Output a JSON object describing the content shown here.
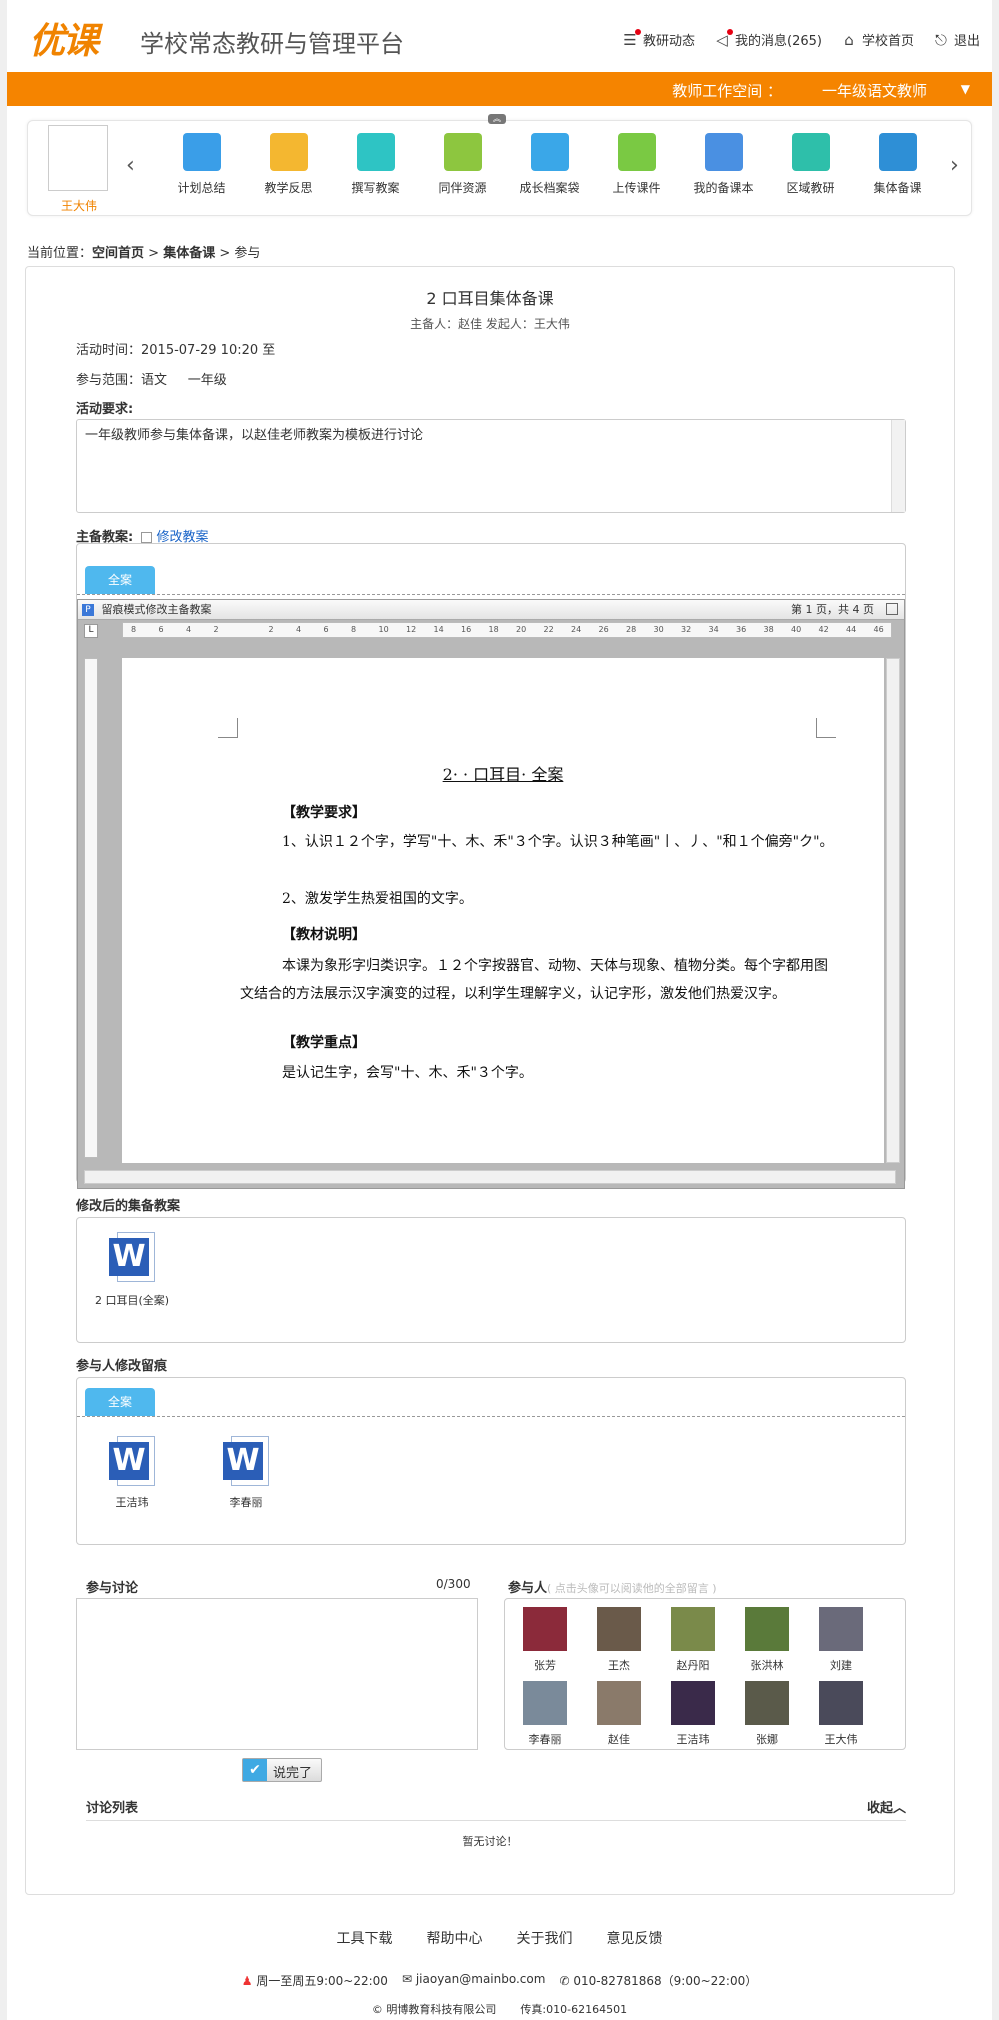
{
  "header": {
    "logo": "优课",
    "platform": "学校常态教研与管理平台",
    "nav": [
      {
        "label": "教研动态",
        "icon": "list-icon"
      },
      {
        "label": "我的消息(265)",
        "icon": "speaker-icon"
      },
      {
        "label": "学校首页",
        "icon": "school-icon"
      },
      {
        "label": "退出",
        "icon": "logout-icon"
      }
    ]
  },
  "workspace": {
    "label": "教师工作空间 ：",
    "grade": "一年级语文教师",
    "caret": "▼"
  },
  "user": {
    "name": "王大伟"
  },
  "tools": [
    {
      "label": "计划总结",
      "color": "#3a9ee8"
    },
    {
      "label": "教学反思",
      "color": "#f4b730"
    },
    {
      "label": "撰写教案",
      "color": "#2ec4c4"
    },
    {
      "label": "同伴资源",
      "color": "#8dc63f"
    },
    {
      "label": "成长档案袋",
      "color": "#3aa7e8"
    },
    {
      "label": "上传课件",
      "color": "#7ac943"
    },
    {
      "label": "我的备课本",
      "color": "#4a90e2"
    },
    {
      "label": "区域教研",
      "color": "#2ebfaa"
    },
    {
      "label": "集体备课",
      "color": "#2e8fd6"
    }
  ],
  "breadcrumb": {
    "prefix": "当前位置：",
    "home": "空间首页",
    "sep": ">",
    "section": "集体备课",
    "current": "参与"
  },
  "activity": {
    "title": "2 口耳目集体备课",
    "meta": "主备人：赵佳   发起人：王大伟",
    "time": "活动时间：2015-07-29 10:20 至",
    "scope_label": "参与范围：",
    "scope_subject": "语文",
    "scope_grade": "一年级",
    "req_label": "活动要求:",
    "requirement": "一年级教师参与集体备课，以赵佳老师教案为模板进行讨论"
  },
  "plan": {
    "label": "主备教案:",
    "edit_link": "修改教案",
    "tab": "全案",
    "doc_bar_title": "留痕模式修改主备教案",
    "page_info": "第 1 页，共 4 页",
    "ruler_ticks": [
      "8",
      "6",
      "4",
      "2",
      "",
      "2",
      "4",
      "6",
      "8",
      "10",
      "12",
      "14",
      "16",
      "18",
      "20",
      "22",
      "24",
      "26",
      "28",
      "30",
      "32",
      "34",
      "36",
      "38",
      "40",
      "42",
      "44",
      "46"
    ],
    "doc": {
      "heading": "2· · 口耳目· 全案",
      "s1": "【教学要求】",
      "p1": "1、认识１２个字，学写\"十、木、禾\"３个字。认识３种笔画\"丨、丿、\"和１个偏旁\"ク\"。",
      "p2": "2、激发学生热爱祖国的文字。",
      "s2": "【教材说明】",
      "p3": "本课为象形字归类识字。１２个字按器官、动物、天体与现象、植物分类。每个字都用图文结合的方法展示汉字演变的过程，以利学生理解字义，认记字形，激发他们热爱汉字。",
      "s3": "【教学重点】",
      "p4": "是认记生字，会写\"十、木、禾\"３个字。"
    }
  },
  "revised": {
    "label": "修改后的集备教案",
    "file": "2 口耳目(全案)"
  },
  "traces": {
    "label": "参与人修改留痕",
    "tab": "全案",
    "files": [
      "王洁玮",
      "李春丽"
    ]
  },
  "discussion": {
    "label": "参与讨论",
    "counter": "0/300",
    "submit": "说完了",
    "list_label": "讨论列表",
    "collapse": "收起",
    "empty": "暂无讨论！"
  },
  "participants": {
    "label": "参与人",
    "hint": "( 点击头像可以阅读他的全部留言 )",
    "people": [
      "张芳",
      "王杰",
      "赵丹阳",
      "张洪林",
      "刘建",
      "李春丽",
      "赵佳",
      "王洁玮",
      "张娜",
      "王大伟"
    ]
  },
  "footer": {
    "links": [
      "工具下载",
      "帮助中心",
      "关于我们",
      "意见反馈"
    ],
    "hours": "周一至周五9:00~22:00",
    "email": "jiaoyan@mainbo.com",
    "phone": "010-82781868（9:00~22:00）",
    "copyright": "© 明博教育科技有限公司",
    "fax": "传真:010-62164501"
  }
}
